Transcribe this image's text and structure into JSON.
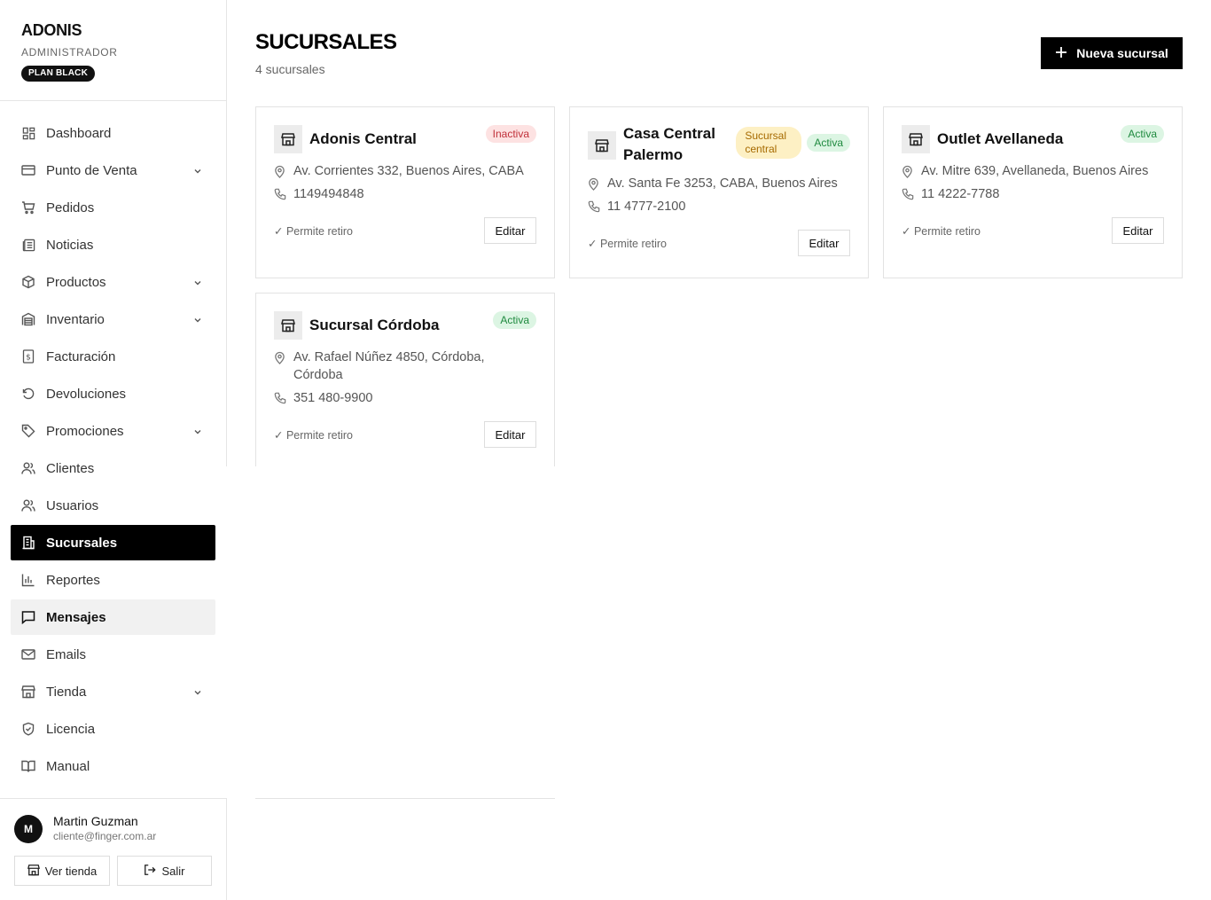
{
  "brand": {
    "name": "ADONIS",
    "role": "ADMINISTRADOR",
    "plan": "PLAN BLACK"
  },
  "nav": [
    {
      "label": "Dashboard",
      "icon": "dashboard-icon",
      "chevron": false
    },
    {
      "label": "Punto de Venta",
      "icon": "credit-card-icon",
      "chevron": true
    },
    {
      "label": "Pedidos",
      "icon": "cart-icon",
      "chevron": false
    },
    {
      "label": "Noticias",
      "icon": "newspaper-icon",
      "chevron": false
    },
    {
      "label": "Productos",
      "icon": "box-icon",
      "chevron": true
    },
    {
      "label": "Inventario",
      "icon": "warehouse-icon",
      "chevron": true
    },
    {
      "label": "Facturación",
      "icon": "invoice-icon",
      "chevron": false
    },
    {
      "label": "Devoluciones",
      "icon": "undo-icon",
      "chevron": false
    },
    {
      "label": "Promociones",
      "icon": "tag-icon",
      "chevron": true
    },
    {
      "label": "Clientes",
      "icon": "users-icon",
      "chevron": false
    },
    {
      "label": "Usuarios",
      "icon": "user-group-icon",
      "chevron": false
    },
    {
      "label": "Sucursales",
      "icon": "building-icon",
      "chevron": false,
      "active": true
    },
    {
      "label": "Reportes",
      "icon": "bar-chart-icon",
      "chevron": false
    },
    {
      "label": "Mensajes",
      "icon": "message-icon",
      "chevron": false,
      "hover": true
    },
    {
      "label": "Emails",
      "icon": "mail-icon",
      "chevron": false
    },
    {
      "label": "Tienda",
      "icon": "store-icon",
      "chevron": true
    },
    {
      "label": "Licencia",
      "icon": "shield-check-icon",
      "chevron": false
    },
    {
      "label": "Manual",
      "icon": "book-icon",
      "chevron": false
    }
  ],
  "user": {
    "initial": "M",
    "name": "Martin Guzman",
    "email": "cliente@finger.com.ar",
    "view_store_label": "Ver tienda",
    "logout_label": "Salir"
  },
  "page": {
    "title": "SUCURSALES",
    "subtitle": "4 sucursales",
    "new_button_label": "Nueva sucursal"
  },
  "branches": [
    {
      "name": "Adonis Central",
      "status": "Inactiva",
      "address": "Av. Corrientes 332, Buenos Aires, CABA",
      "phone": "1149494848",
      "pickup": "✓ Permite retiro",
      "edit_label": "Editar"
    },
    {
      "name": "Casa Central Palermo",
      "central_label": "Sucursal central",
      "status": "Activa",
      "address": "Av. Santa Fe 3253, CABA, Buenos Aires",
      "phone": "11 4777-2100",
      "pickup": "✓ Permite retiro",
      "edit_label": "Editar"
    },
    {
      "name": "Outlet Avellaneda",
      "status": "Activa",
      "address": "Av. Mitre 639, Avellaneda, Buenos Aires",
      "phone": "11 4222-7788",
      "pickup": "✓ Permite retiro",
      "edit_label": "Editar"
    },
    {
      "name": "Sucursal Córdoba",
      "status": "Activa",
      "address": "Av. Rafael Núñez 4850, Córdoba, Córdoba",
      "phone": "351 480-9900",
      "pickup": "✓ Permite retiro",
      "edit_label": "Editar"
    }
  ],
  "colors": {
    "accent": "#000000",
    "inactive": "#c0303a",
    "active": "#1f8a3f",
    "central": "#a66a00"
  }
}
